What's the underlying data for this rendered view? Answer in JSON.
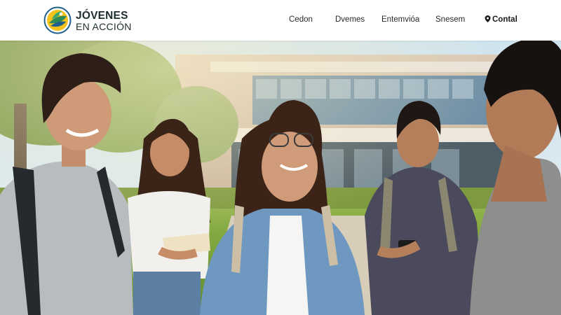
{
  "brand": {
    "line1": "JÓVENES",
    "line2": "EN ACCIÓN",
    "logo_icon": "leaf-circle-logo"
  },
  "nav": {
    "items": [
      {
        "label": "Cedon"
      },
      {
        "label": "Dvemes"
      },
      {
        "label": "Entemvióa"
      },
      {
        "label": "Snesem"
      }
    ],
    "contact_label": "Contal",
    "contact_icon": "map-pin-icon"
  },
  "hero": {
    "scene": "students-outdoors-campus-photo"
  },
  "colors": {
    "header_bg": "#ffffff",
    "text_dark": "#1d2b2e",
    "logo_green": "#2e8b57",
    "logo_yellow": "#e6b400",
    "logo_blue": "#1f5f8b"
  }
}
